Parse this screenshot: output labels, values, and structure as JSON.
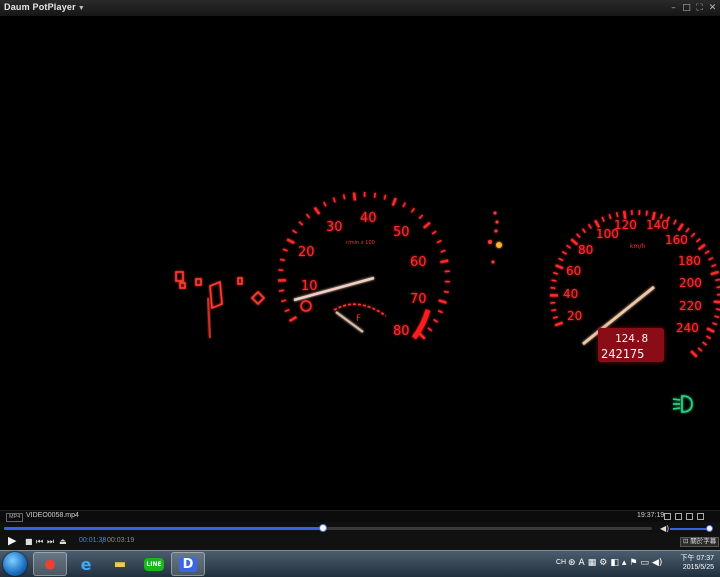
{
  "window": {
    "title": "Daum PotPlayer"
  },
  "gauges": {
    "tach_numbers": [
      "10",
      "20",
      "30",
      "40",
      "50",
      "60",
      "70",
      "80"
    ],
    "tach_unit": "r/min x 100",
    "speed_numbers": [
      "20",
      "40",
      "60",
      "80",
      "100",
      "120",
      "140",
      "160",
      "180",
      "200",
      "220",
      "240"
    ],
    "speed_unit": "km/h",
    "fuel_f": "F",
    "trip": "124.8",
    "odometer": "242175"
  },
  "infobar": {
    "format": "MP4",
    "filename": "VIDEO0058.mp4",
    "clock": "19:37:19"
  },
  "playback": {
    "current": "00:01:38",
    "total": "00:03:19",
    "progress": 0.493,
    "volume": 0.95,
    "cc_label": "關於字幕"
  },
  "taskbar": {
    "apps": [
      {
        "name": "chrome",
        "glyph": "●"
      },
      {
        "name": "ie",
        "glyph": "e"
      },
      {
        "name": "explorer",
        "glyph": "▬"
      },
      {
        "name": "line",
        "glyph": "LINE"
      },
      {
        "name": "potplayer",
        "glyph": "D"
      }
    ],
    "lang": "CH",
    "time": "下午 07:37",
    "date": "2015/5/25"
  }
}
